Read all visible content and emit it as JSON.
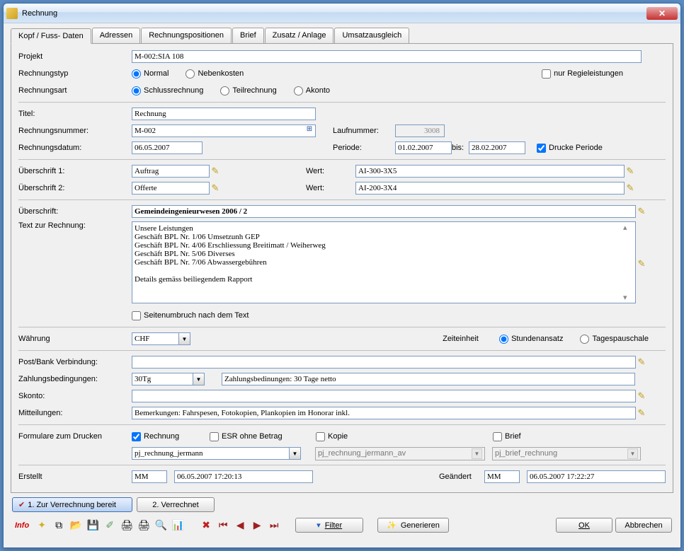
{
  "window": {
    "title": "Rechnung"
  },
  "tabs": [
    "Kopf / Fuss- Daten",
    "Adressen",
    "Rechnungspositionen",
    "Brief",
    "Zusatz / Anlage",
    "Umsatzausgleich"
  ],
  "active_tab": 0,
  "labels": {
    "projekt": "Projekt",
    "rechnungstyp": "Rechnungstyp",
    "rechnungsart": "Rechnungsart",
    "titel": "Titel:",
    "rechnungsnummer": "Rechnungsnummer:",
    "rechnungsdatum": "Rechnungsdatum:",
    "laufnummer": "Laufnummer:",
    "periode": "Periode:",
    "bis": "bis:",
    "drucke_periode": "Drucke Periode",
    "ueberschrift1": "Überschrift 1:",
    "ueberschrift2": "Überschrift 2:",
    "wert": "Wert:",
    "ueberschrift": "Überschrift:",
    "text_zur_rechnung": "Text zur Rechnung:",
    "seitenumbruch": "Seitenumbruch nach dem Text",
    "waehrung": "Währung",
    "zeiteinheit": "Zeiteinheit",
    "post_bank": "Post/Bank Verbindung:",
    "zahlungsbedingungen": "Zahlungsbedingungen:",
    "skonto": "Skonto:",
    "mitteilungen": "Mitteilungen:",
    "formulare": "Formulare zum Drucken",
    "erstellt": "Erstellt",
    "geaendert": "Geändert"
  },
  "values": {
    "projekt": "M-002:SIA 108",
    "titel": "Rechnung",
    "rechnungsnummer": "M-002",
    "rechnungsdatum": "06.05.2007",
    "laufnummer": "3008",
    "periode_von": "01.02.2007",
    "periode_bis": "28.02.2007",
    "ueberschrift1": "Auftrag",
    "ueberschrift2": "Offerte",
    "wert1": "AI-300-3X5",
    "wert2": "AI-200-3X4",
    "ueberschrift": "Gemeindeingenieurwesen 2006 / 2",
    "text": "Unsere Leistungen\nGeschäft BPL Nr. 1/06 Umsetzunh GEP\nGeschäft BPL Nr. 4/06 Erschliessung Breitimatt / Weiherweg\nGeschäft BPL Nr. 5/06 Diverses\nGeschäft BPL Nr. 7/06 Abwassergebühren\n\nDetails gemäss beiliegendem Rapport",
    "waehrung": "CHF",
    "post_bank": "",
    "zahlungsbed_code": "30Tg",
    "zahlungsbed_text": "Zahlungsbedinungen: 30 Tage netto",
    "skonto": "",
    "mitteilungen": "Bemerkungen: Fahrspesen, Fotokopien, Plankopien im Honorar inkl.",
    "erstellt_user": "MM",
    "erstellt_ts": "06.05.2007 17:20:13",
    "geaendert_user": "MM",
    "geaendert_ts": "06.05.2007 17:22:27"
  },
  "radios": {
    "rechnungstyp": {
      "options": [
        "Normal",
        "Nebenkosten"
      ],
      "selected": "Normal"
    },
    "rechnungsart": {
      "options": [
        "Schlussrechnung",
        "Teilrechnung",
        "Akonto"
      ],
      "selected": "Schlussrechnung"
    },
    "zeiteinheit": {
      "options": [
        "Stundenansatz",
        "Tagespauschale"
      ],
      "selected": "Stundenansatz"
    }
  },
  "checkboxes": {
    "nur_regieleistungen": {
      "label": "nur Regieleistungen",
      "checked": false
    },
    "drucke_periode": {
      "checked": true
    },
    "seitenumbruch": {
      "checked": false
    },
    "rechnung": {
      "label": "Rechnung",
      "checked": true
    },
    "esr": {
      "label": "ESR ohne Betrag",
      "checked": false
    },
    "kopie": {
      "label": "Kopie",
      "checked": false
    },
    "brief": {
      "label": "Brief",
      "checked": false
    }
  },
  "print_selects": [
    "pj_rechnung_jermann",
    "pj_rechnung_jermann_av",
    "pj_brief_rechnung"
  ],
  "buttons": {
    "bereit": "1.  Zur Verrechnung bereit",
    "verrechnet": "2.  Verrechnet",
    "filter": "Filter",
    "generieren": "Generieren",
    "ok": "OK",
    "abbrechen": "Abbrechen"
  },
  "toolbar": {
    "info": "Info"
  }
}
